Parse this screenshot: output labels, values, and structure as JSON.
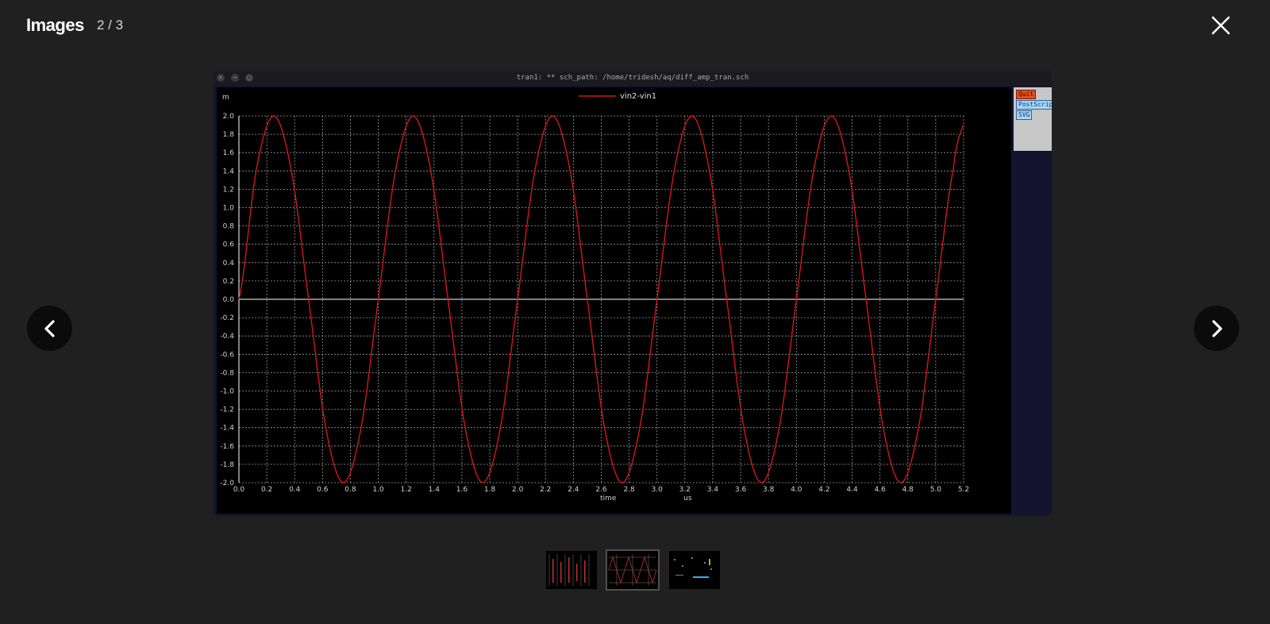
{
  "header": {
    "title": "Images",
    "counter": "2 / 3"
  },
  "icons": {
    "close": "close-icon",
    "prev": "chevron-left-icon",
    "next": "chevron-right-icon"
  },
  "screenshot": {
    "window_title": "tran1: ** sch_path: /home/tridesh/aq/diff_amp_tran.sch",
    "window_buttons": [
      "×",
      "−",
      "○"
    ],
    "side_buttons": {
      "quit": "Quit",
      "postscript": "PostScript",
      "svg": "SVG"
    },
    "colors": {
      "background": "#000000",
      "grid": "#9a9a9a",
      "trace": "#d01818",
      "quit_button": "#e0521e",
      "panel": "#c7c7c7"
    }
  },
  "chart_data": {
    "type": "line",
    "ylabel": "m",
    "xlabel": "time",
    "xunit": "us",
    "xlim": [
      0,
      5.2
    ],
    "ylim": [
      -2.0,
      2.0
    ],
    "grid": true,
    "legend": "top-center",
    "xticks": [
      "0.0",
      "0.2",
      "0.4",
      "0.6",
      "0.8",
      "1.0",
      "1.2",
      "1.4",
      "1.6",
      "1.8",
      "2.0",
      "2.2",
      "2.4",
      "2.6",
      "2.8",
      "3.0",
      "3.2",
      "3.4",
      "3.6",
      "3.8",
      "4.0",
      "4.2",
      "4.4",
      "4.6",
      "4.8",
      "5.0",
      "5.2"
    ],
    "yticks": [
      "2.0",
      "1.8",
      "1.6",
      "1.4",
      "1.2",
      "1.0",
      "0.8",
      "0.6",
      "0.4",
      "0.2",
      "0.0",
      "-0.2",
      "-0.4",
      "-0.6",
      "-0.8",
      "-1.0",
      "-1.2",
      "-1.4",
      "-1.6",
      "-1.8",
      "-2.0"
    ],
    "series": [
      {
        "name": "vin2-vin1",
        "color": "#d01818",
        "x": [
          0.0,
          0.125,
          0.25,
          0.375,
          0.5,
          0.625,
          0.75,
          0.875,
          1.0,
          1.125,
          1.25,
          1.375,
          1.5,
          1.625,
          1.75,
          1.875,
          2.0,
          2.125,
          2.25,
          2.375,
          2.5,
          2.625,
          2.75,
          2.875,
          3.0,
          3.125,
          3.25,
          3.375,
          3.5,
          3.625,
          3.75,
          3.875,
          4.0,
          4.125,
          4.25,
          4.375,
          4.5,
          4.625,
          4.75,
          4.875,
          5.0,
          5.125,
          5.2
        ],
        "y": [
          0.0,
          1.414,
          2.0,
          1.414,
          0.0,
          -1.414,
          -2.0,
          -1.414,
          0.0,
          1.414,
          2.0,
          1.414,
          0.0,
          -1.414,
          -2.0,
          -1.414,
          0.0,
          1.414,
          2.0,
          1.414,
          0.0,
          -1.414,
          -2.0,
          -1.414,
          0.0,
          1.414,
          2.0,
          1.414,
          0.0,
          -1.414,
          -2.0,
          -1.414,
          0.0,
          1.414,
          2.0,
          1.414,
          0.0,
          -1.414,
          -2.0,
          -1.414,
          0.0,
          1.414,
          1.902
        ]
      }
    ]
  }
}
